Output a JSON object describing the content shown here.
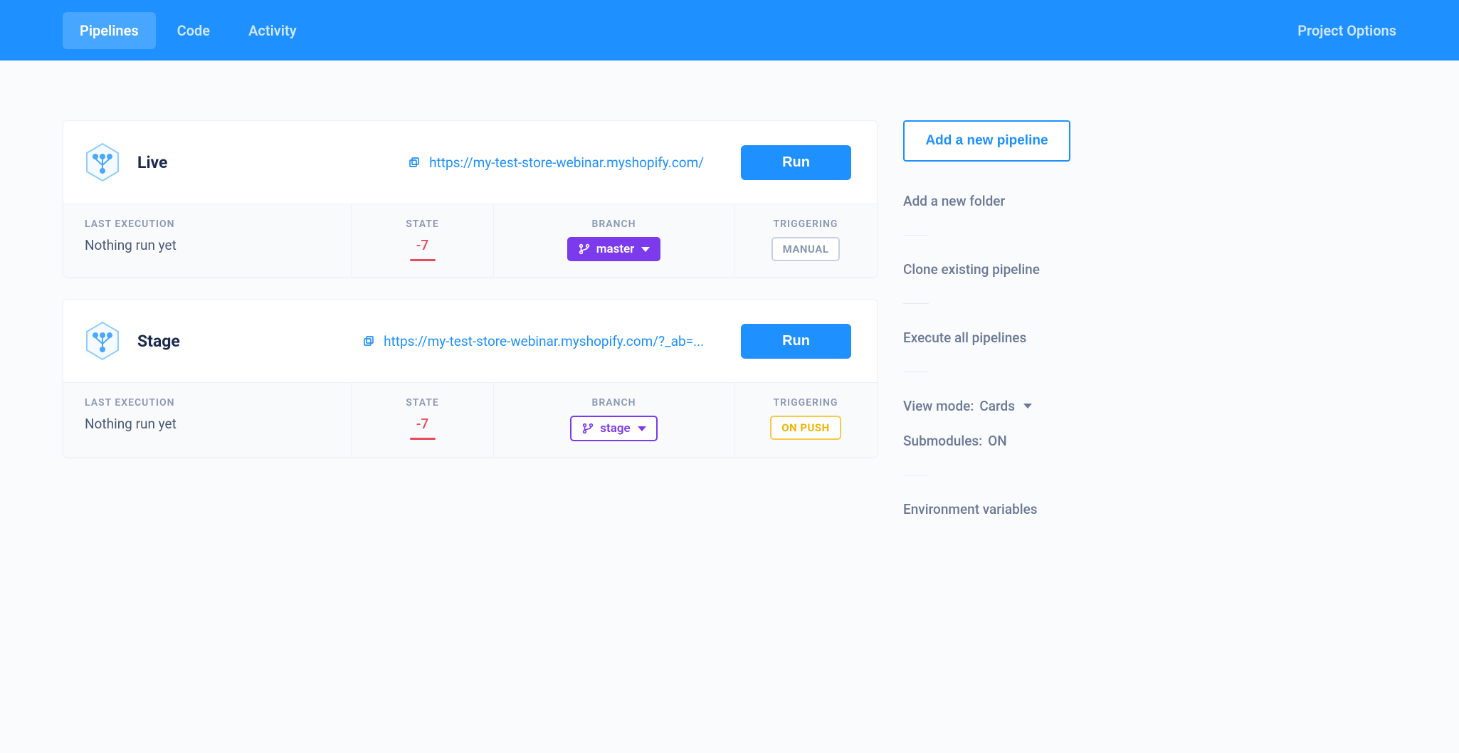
{
  "nav": {
    "tabs": [
      "Pipelines",
      "Code",
      "Activity"
    ],
    "active_index": 0,
    "project_options": "Project Options"
  },
  "labels": {
    "last_execution": "LAST EXECUTION",
    "state": "STATE",
    "branch": "BRANCH",
    "triggering": "TRIGGERING",
    "run": "Run"
  },
  "pipelines": [
    {
      "name": "Live",
      "url": "https://my-test-store-webinar.myshopify.com/",
      "last_execution": "Nothing run yet",
      "state": "-7",
      "branch": "master",
      "branch_style": "solid",
      "triggering": "MANUAL",
      "trigger_style": "manual"
    },
    {
      "name": "Stage",
      "url": "https://my-test-store-webinar.myshopify.com/?_ab=...",
      "last_execution": "Nothing run yet",
      "state": "-7",
      "branch": "stage",
      "branch_style": "outline",
      "triggering": "ON PUSH",
      "trigger_style": "onpush"
    }
  ],
  "sidebar": {
    "add_pipeline": "Add a new pipeline",
    "add_folder": "Add a new folder",
    "clone": "Clone existing pipeline",
    "execute_all": "Execute all pipelines",
    "view_mode_label": "View mode:",
    "view_mode_value": "Cards",
    "submodules_label": "Submodules:",
    "submodules_value": "ON",
    "env_vars": "Environment variables"
  }
}
